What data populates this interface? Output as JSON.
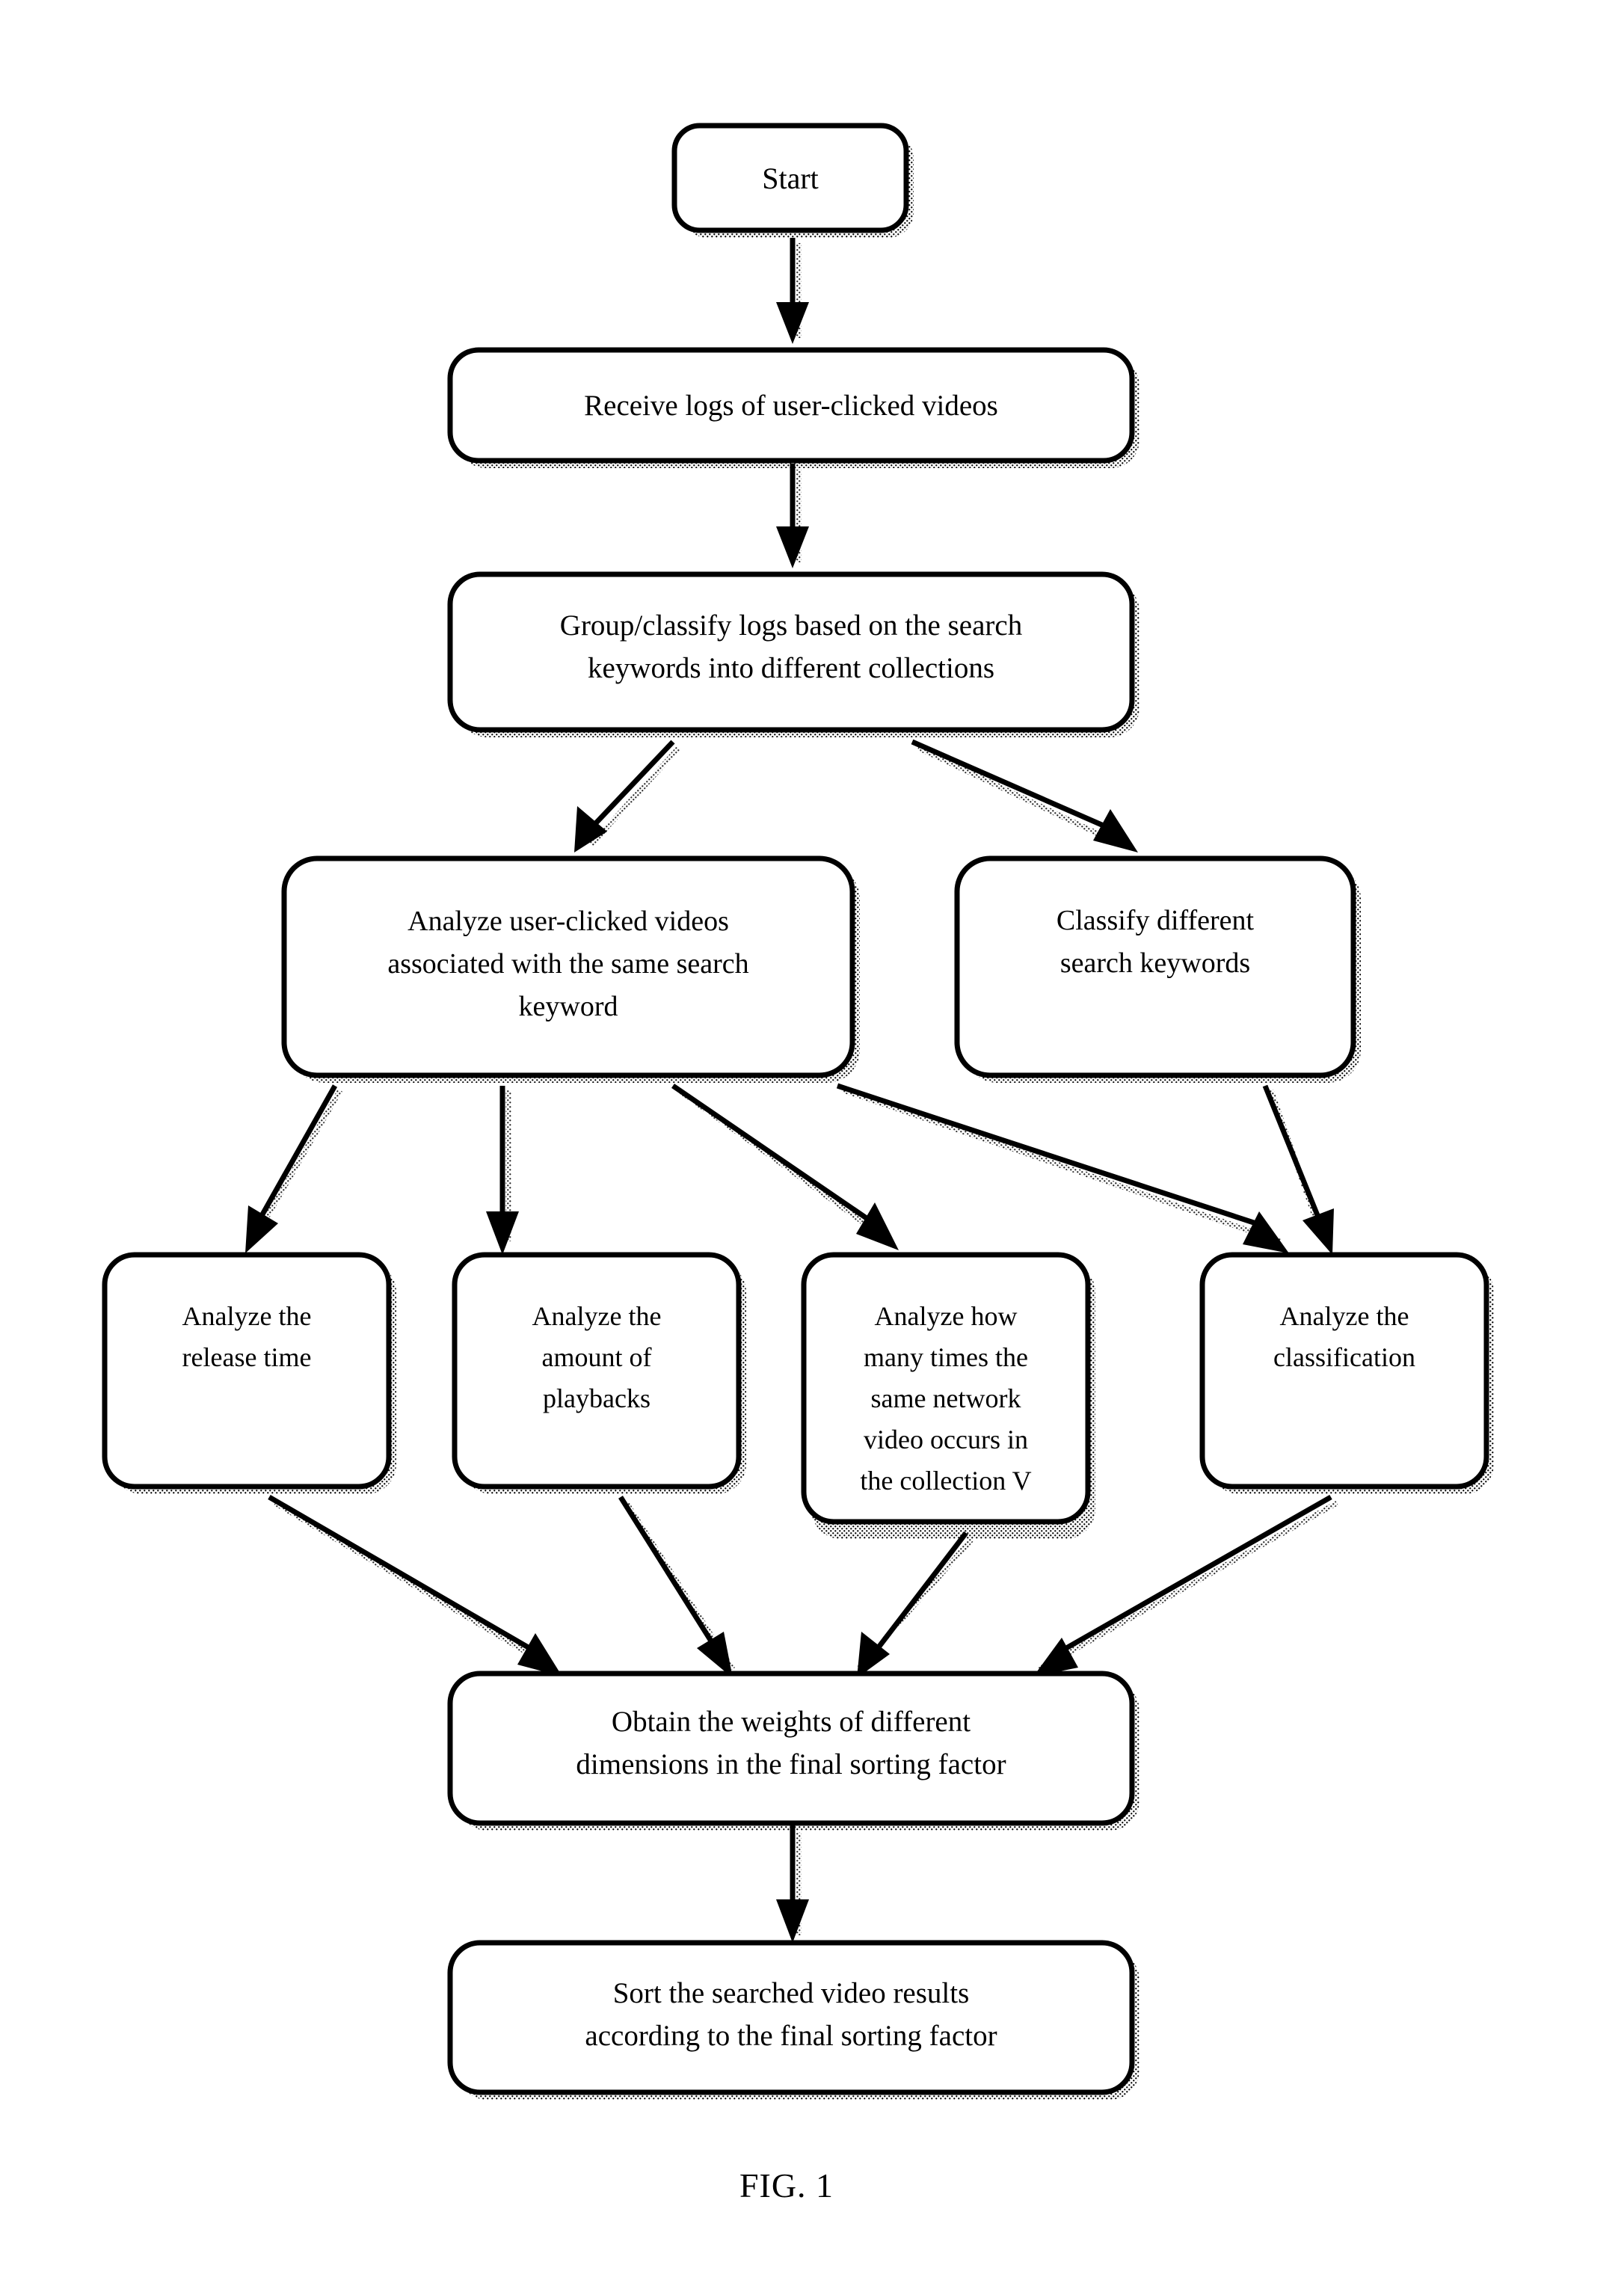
{
  "figure": {
    "caption": "FIG. 1",
    "type": "flowchart"
  },
  "nodes": [
    {
      "id": "start",
      "lines": [
        "Start"
      ]
    },
    {
      "id": "receive",
      "lines": [
        "Receive logs of user-clicked videos"
      ]
    },
    {
      "id": "group",
      "lines": [
        "Group/classify logs based on the search",
        "keywords into different collections"
      ]
    },
    {
      "id": "analyze_videos",
      "lines": [
        "Analyze user-clicked videos",
        "associated with the same search",
        "keyword"
      ]
    },
    {
      "id": "classify_keywords",
      "lines": [
        "Classify different",
        "search keywords"
      ]
    },
    {
      "id": "release_time",
      "lines": [
        "Analyze the",
        "release time"
      ]
    },
    {
      "id": "playbacks",
      "lines": [
        "Analyze the",
        "amount of",
        "playbacks"
      ]
    },
    {
      "id": "occurrences",
      "lines": [
        "Analyze how",
        "many times the",
        "same network",
        "video occurs in",
        "the collection V"
      ]
    },
    {
      "id": "classification",
      "lines": [
        "Analyze the",
        "classification"
      ]
    },
    {
      "id": "weights",
      "lines": [
        "Obtain the weights of different",
        "dimensions in the final sorting factor"
      ]
    },
    {
      "id": "sort",
      "lines": [
        "Sort the searched video results",
        "according to the final sorting factor"
      ]
    }
  ],
  "edges": [
    {
      "from": "start",
      "to": "receive"
    },
    {
      "from": "receive",
      "to": "group"
    },
    {
      "from": "group",
      "to": "analyze_videos"
    },
    {
      "from": "group",
      "to": "classify_keywords"
    },
    {
      "from": "analyze_videos",
      "to": "release_time"
    },
    {
      "from": "analyze_videos",
      "to": "playbacks"
    },
    {
      "from": "analyze_videos",
      "to": "occurrences"
    },
    {
      "from": "analyze_videos",
      "to": "classification"
    },
    {
      "from": "classify_keywords",
      "to": "classification"
    },
    {
      "from": "release_time",
      "to": "weights"
    },
    {
      "from": "playbacks",
      "to": "weights"
    },
    {
      "from": "occurrences",
      "to": "weights"
    },
    {
      "from": "classification",
      "to": "weights"
    },
    {
      "from": "weights",
      "to": "sort"
    }
  ],
  "colors": {
    "stroke": "#000000",
    "fill": "#ffffff",
    "background": "#ffffff"
  },
  "labels": {
    "start": "Start",
    "receive_l1": "Receive logs of user-clicked videos",
    "group_l1": "Group/classify logs based on the search",
    "group_l2": "keywords into different collections",
    "analyze_videos_l1": "Analyze user-clicked videos",
    "analyze_videos_l2": "associated with the same search",
    "analyze_videos_l3": "keyword",
    "classify_keywords_l1": "Classify different",
    "classify_keywords_l2": "search keywords",
    "release_time_l1": "Analyze the",
    "release_time_l2": "release time",
    "playbacks_l1": "Analyze the",
    "playbacks_l2": "amount of",
    "playbacks_l3": "playbacks",
    "occurrences_l1": "Analyze how",
    "occurrences_l2": "many times the",
    "occurrences_l3": "same network",
    "occurrences_l4": "video occurs in",
    "occurrences_l5": "the collection V",
    "classification_l1": "Analyze the",
    "classification_l2": "classification",
    "weights_l1": "Obtain the weights of different",
    "weights_l2": "dimensions in the final sorting factor",
    "sort_l1": "Sort the searched video results",
    "sort_l2": "according to the final sorting factor",
    "caption": "FIG. 1"
  }
}
